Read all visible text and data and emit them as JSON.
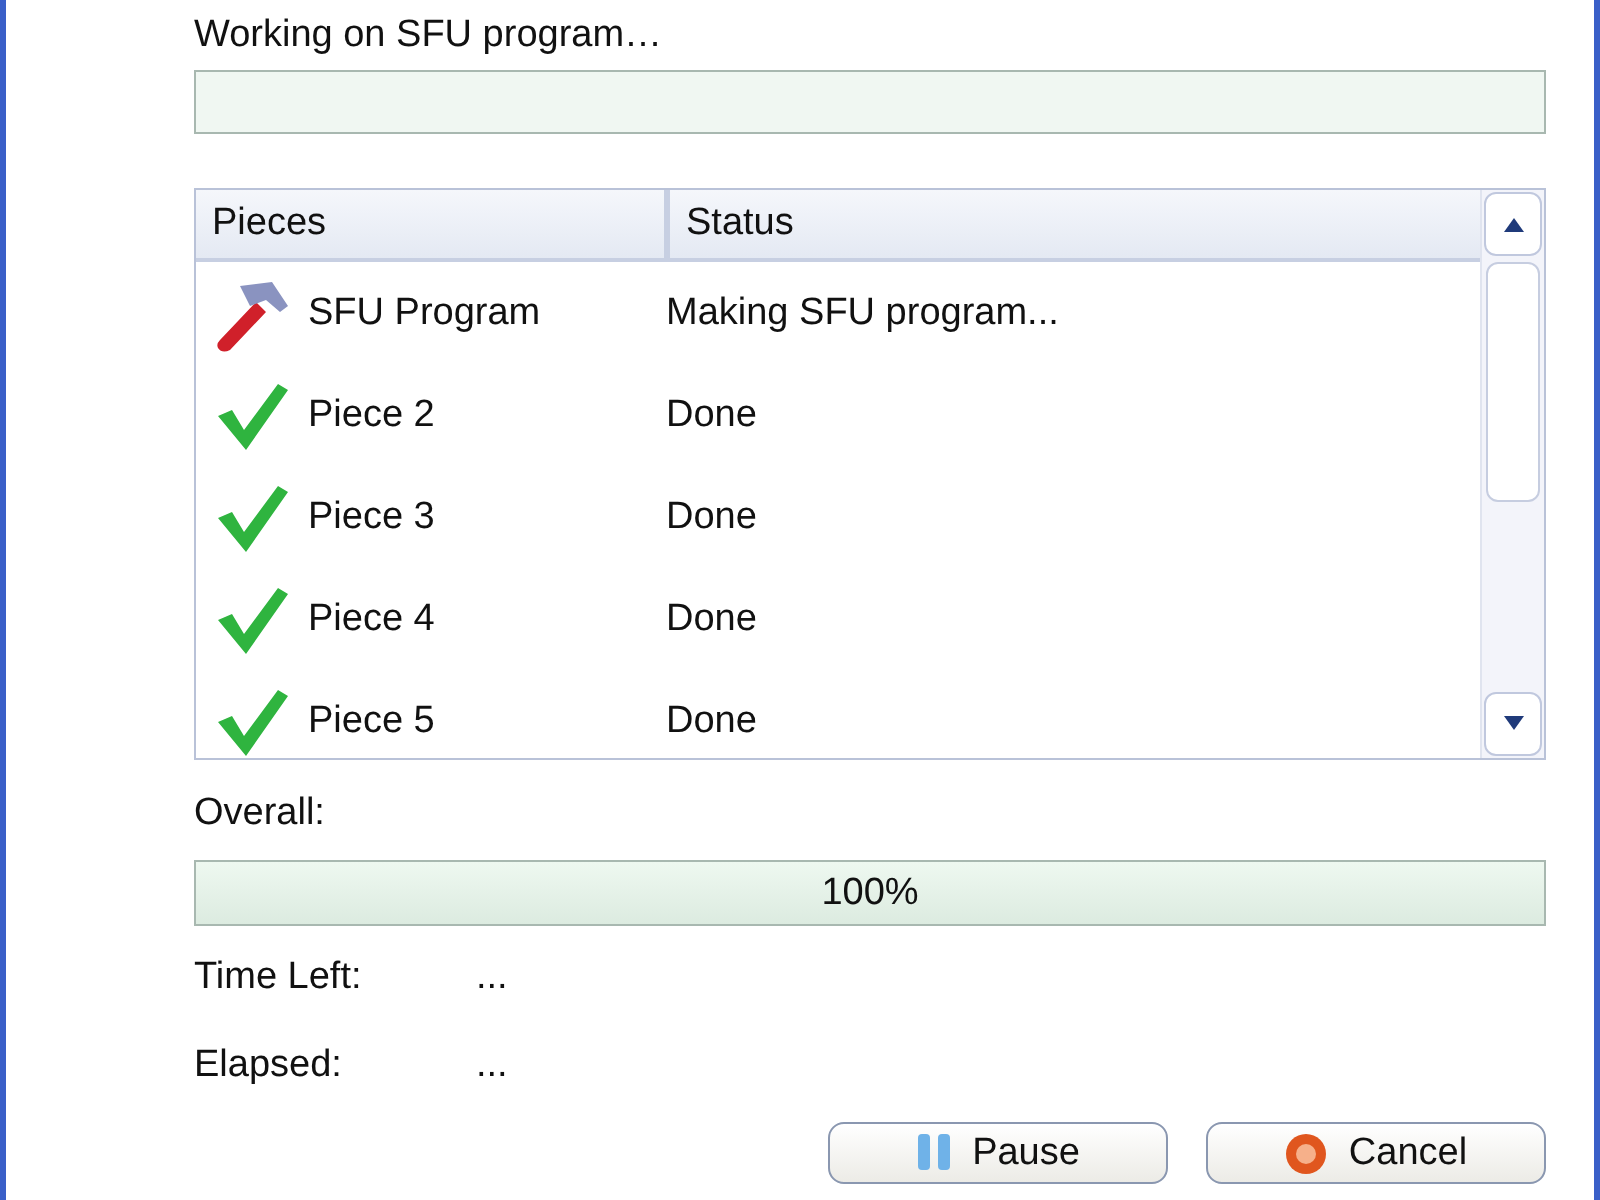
{
  "task": {
    "label": "Working on SFU program…"
  },
  "pieces_list": {
    "columns": [
      "Pieces",
      "Status"
    ],
    "rows": [
      {
        "kind": "building",
        "piece": "SFU Program",
        "status": "Making SFU program..."
      },
      {
        "kind": "done",
        "piece": "Piece 2",
        "status": "Done"
      },
      {
        "kind": "done",
        "piece": "Piece 3",
        "status": "Done"
      },
      {
        "kind": "done",
        "piece": "Piece 4",
        "status": "Done"
      },
      {
        "kind": "done",
        "piece": "Piece 5",
        "status": "Done"
      }
    ]
  },
  "overall": {
    "label": "Overall:",
    "level": 1,
    "reading": "100%"
  },
  "time_left": {
    "label": "Time Left:",
    "value": "..."
  },
  "elapsed": {
    "label": "Elapsed:",
    "value": "..."
  },
  "buttons": [
    {
      "kind": "pause",
      "label": "Pause"
    },
    {
      "kind": "cancel",
      "label": "Cancel"
    }
  ]
}
